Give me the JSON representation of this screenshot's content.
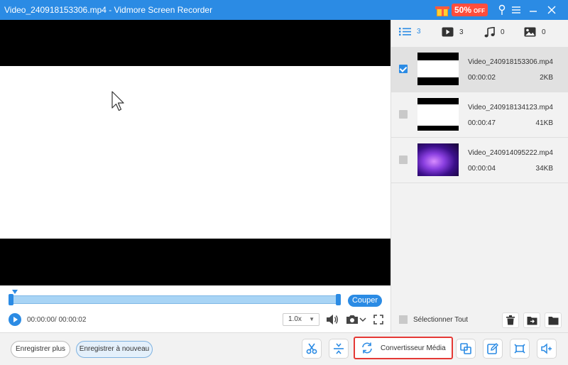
{
  "window": {
    "title": "Video_240918153306.mp4  -  Vidmore Screen Recorder",
    "promo_percent": "50%",
    "promo_suffix": "OFF"
  },
  "tabs": [
    {
      "icon": "list-icon",
      "count": "3"
    },
    {
      "icon": "video-icon",
      "count": "3"
    },
    {
      "icon": "music-icon",
      "count": "0"
    },
    {
      "icon": "image-icon",
      "count": "0"
    }
  ],
  "recordings": [
    {
      "name": "Video_240918153306.mp4",
      "duration": "00:00:02",
      "size": "2KB",
      "checked": true
    },
    {
      "name": "Video_240918134123.mp4",
      "duration": "00:00:47",
      "size": "41KB",
      "checked": false
    },
    {
      "name": "Video_240914095222.mp4",
      "duration": "00:00:04",
      "size": "34KB",
      "checked": false
    }
  ],
  "player": {
    "time": "00:00:00/ 00:00:02",
    "speed": "1.0x",
    "cut_label": "Couper"
  },
  "panel": {
    "select_all_label": "Sélectionner Tout"
  },
  "bottom": {
    "record_more": "Enregistrer plus",
    "record_again": "Enregistrer à nouveau",
    "converter_label": "Convertisseur Média"
  },
  "colors": {
    "accent": "#2b8be4",
    "highlight": "#e53935",
    "promo": "#ff4d3c"
  }
}
